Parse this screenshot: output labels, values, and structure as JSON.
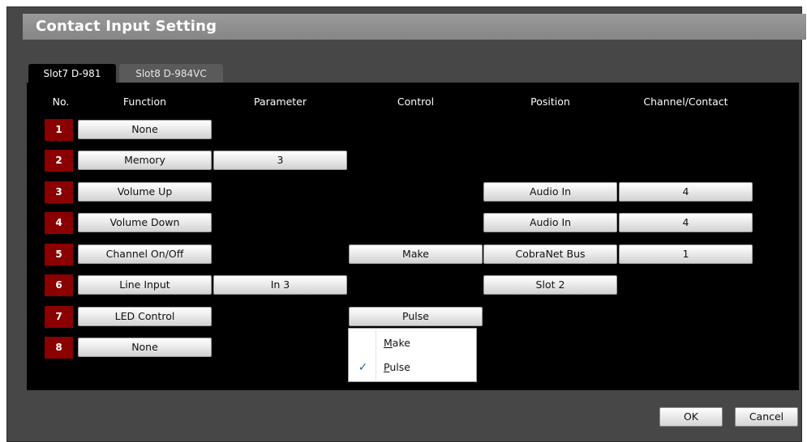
{
  "dialog": {
    "title": "Contact Input Setting"
  },
  "tabs": [
    {
      "label": "Slot7  D-981",
      "active": true
    },
    {
      "label": "Slot8  D-984VC",
      "active": false
    }
  ],
  "headers": [
    "No.",
    "Function",
    "Parameter",
    "Control",
    "Position",
    "Channel/Contact"
  ],
  "rows": [
    {
      "no": "1",
      "function": "None",
      "parameter": "",
      "control": "",
      "position": "",
      "channel": ""
    },
    {
      "no": "2",
      "function": "Memory",
      "parameter": "3",
      "control": "",
      "position": "",
      "channel": ""
    },
    {
      "no": "3",
      "function": "Volume Up",
      "parameter": "",
      "control": "",
      "position": "Audio In",
      "channel": "4"
    },
    {
      "no": "4",
      "function": "Volume Down",
      "parameter": "",
      "control": "",
      "position": "Audio In",
      "channel": "4"
    },
    {
      "no": "5",
      "function": "Channel On/Off",
      "parameter": "",
      "control": "Make",
      "position": "CobraNet Bus",
      "channel": "1"
    },
    {
      "no": "6",
      "function": "Line Input",
      "parameter": "In 3",
      "control": "",
      "position": "Slot 2",
      "channel": ""
    },
    {
      "no": "7",
      "function": "LED Control",
      "parameter": "",
      "control": "Pulse",
      "position": "",
      "channel": ""
    },
    {
      "no": "8",
      "function": "None",
      "parameter": "",
      "control": "",
      "position": "",
      "channel": ""
    }
  ],
  "control_dropdown": {
    "options": [
      {
        "first": "M",
        "rest": "ake",
        "checked": false
      },
      {
        "first": "P",
        "rest": "ulse",
        "checked": true
      }
    ],
    "check_glyph": "✓"
  },
  "footer": {
    "ok_label": "OK",
    "cancel_label": "Cancel"
  },
  "colors": {
    "number_badge": "#8b0000",
    "panel": "#000000",
    "dialog": "#474747",
    "title_bar": "#8f8f8f"
  }
}
